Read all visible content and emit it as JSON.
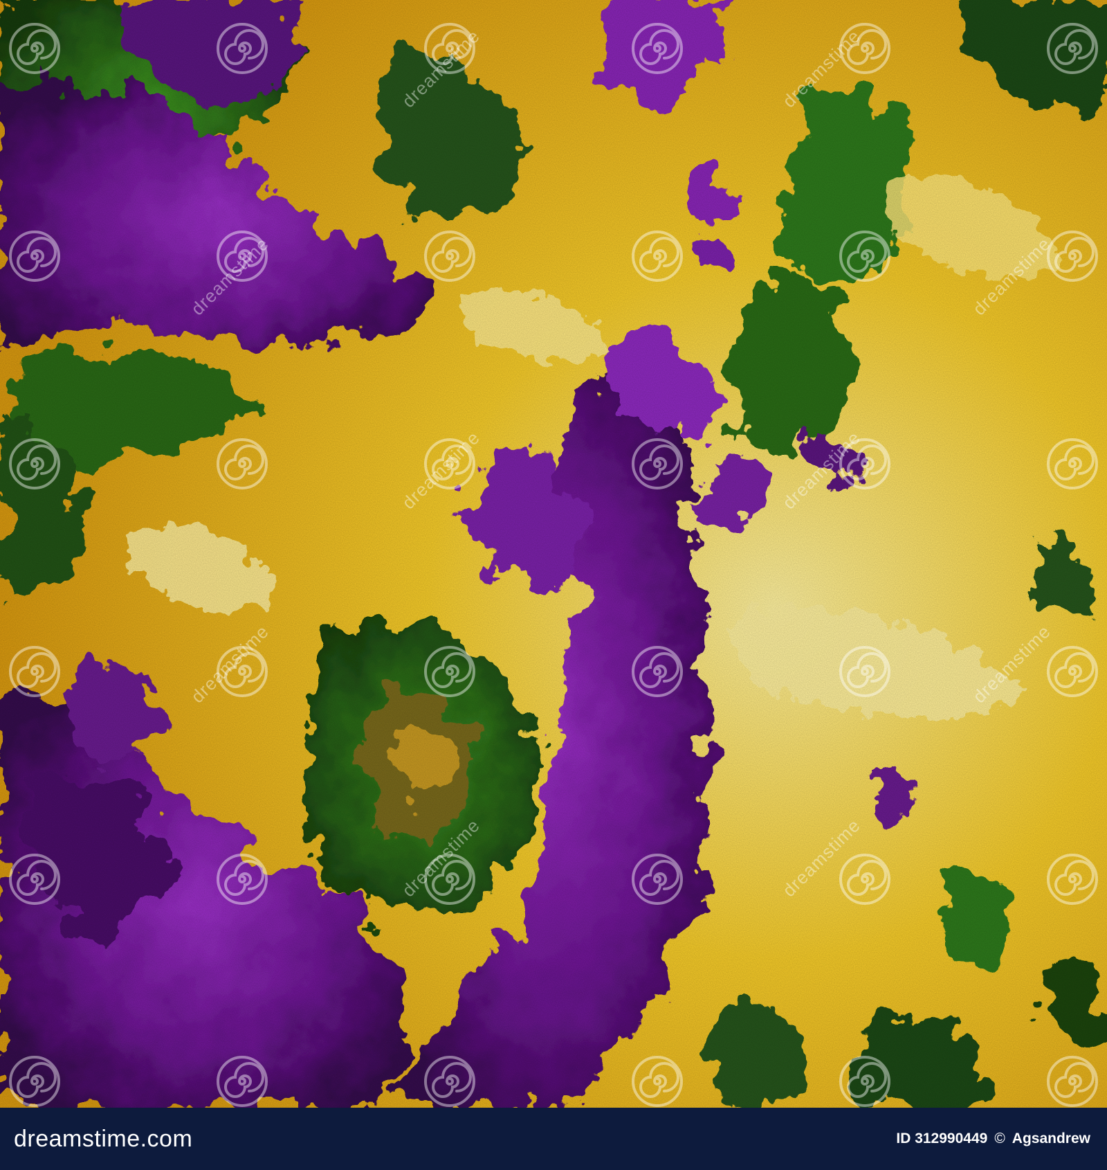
{
  "footer": {
    "brand": "dreamstime.com",
    "id_label": "ID 312990449",
    "copyright_symbol": "©",
    "author": "Agsandrew"
  },
  "watermark": {
    "word": "dreamstime",
    "icon": "spiral-logo-icon"
  },
  "colors": {
    "gold": "#f2c318",
    "yellow": "#ffe36a",
    "purple": "#7a1fa0",
    "deep_purple": "#3b0a55",
    "green": "#2f7a1a",
    "dark_green": "#1e3d12",
    "footer_bg": "#0d1b3d"
  }
}
